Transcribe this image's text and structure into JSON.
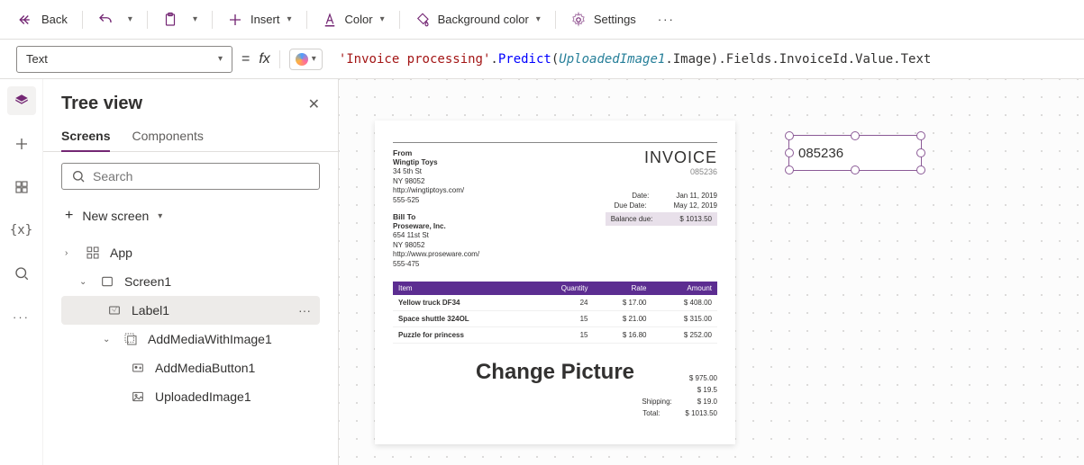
{
  "toolbar": {
    "back": "Back",
    "insert": "Insert",
    "color": "Color",
    "bg_color": "Background color",
    "settings": "Settings"
  },
  "formula": {
    "property": "Text",
    "equals": "=",
    "fx": "fx",
    "parts": {
      "p1": "'Invoice processing'",
      "p2": ".",
      "p3": "Predict",
      "p4": "(",
      "p5": "UploadedImage1",
      "p6": ".Image).Fields.InvoiceId.Value.Text"
    }
  },
  "tree": {
    "title": "Tree view",
    "tabs": {
      "screens": "Screens",
      "components": "Components"
    },
    "search_placeholder": "Search",
    "new_screen": "New screen",
    "nodes": {
      "app": "App",
      "screen1": "Screen1",
      "label1": "Label1",
      "addmedia": "AddMediaWithImage1",
      "addbutton": "AddMediaButton1",
      "uploaded": "UploadedImage1"
    }
  },
  "canvas": {
    "label_value": "085236",
    "change_picture": "Change Picture",
    "invoice": {
      "from_label": "From",
      "from_name": "Wingtip Toys",
      "from_addr1": "34 5th St",
      "from_addr2": "NY 98052",
      "from_url": "http://wingtiptoys.com/",
      "from_phone": "555-525",
      "billto_label": "Bill To",
      "billto_name": "Proseware, Inc.",
      "billto_addr1": "654 11st St",
      "billto_addr2": "NY 98052",
      "billto_url": "http://www.proseware.com/",
      "billto_phone": "555-475",
      "title": "INVOICE",
      "number": "085236",
      "date_label": "Date:",
      "date": "Jan 11, 2019",
      "due_label": "Due Date:",
      "due": "May 12, 2019",
      "balance_label": "Balance due:",
      "balance": "$ 1013.50",
      "headers": {
        "item": "Item",
        "qty": "Quantity",
        "rate": "Rate",
        "amount": "Amount"
      },
      "rows": [
        {
          "item": "Yellow truck DF34",
          "qty": "24",
          "rate": "$ 17.00",
          "amount": "$ 408.00"
        },
        {
          "item": "Space shuttle 324OL",
          "qty": "15",
          "rate": "$ 21.00",
          "amount": "$ 315.00"
        },
        {
          "item": "Puzzle for princess",
          "qty": "15",
          "rate": "$ 16.80",
          "amount": "$ 252.00"
        }
      ],
      "totals": {
        "sub": "$ 975.00",
        "tax": "$ 19.5",
        "ship_label": "Shipping:",
        "ship": "$ 19.0",
        "total_label": "Total:",
        "total": "$ 1013.50"
      }
    }
  }
}
